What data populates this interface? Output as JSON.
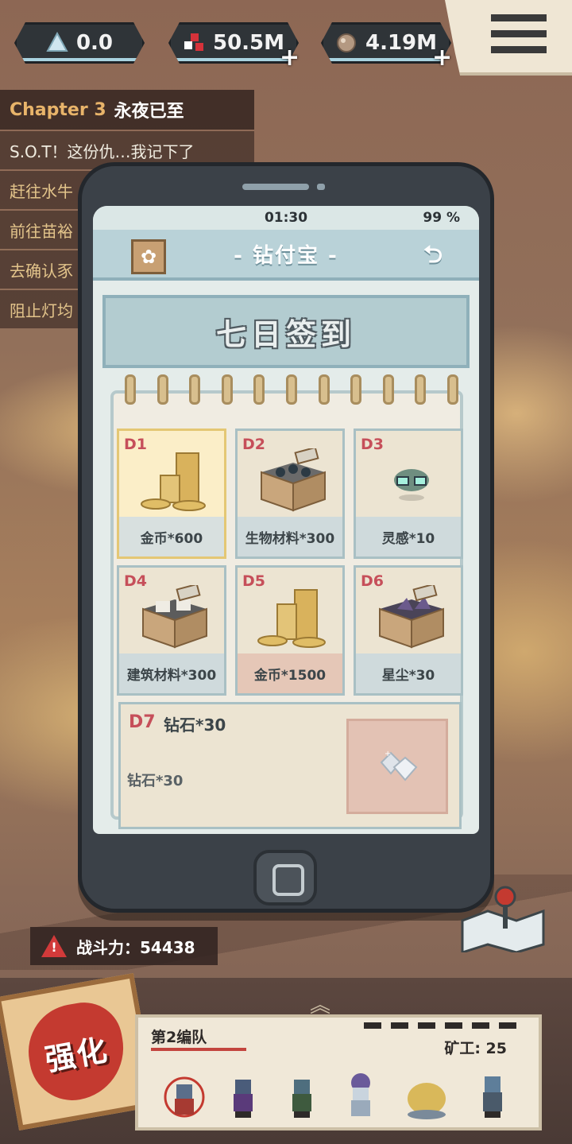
{
  "resources": [
    {
      "icon": "crystal-icon",
      "value": "0.0",
      "plus": false
    },
    {
      "icon": "gene-cube-icon",
      "value": "50.5M",
      "plus": true
    },
    {
      "icon": "ore-icon",
      "value": "4.19M",
      "plus": true
    }
  ],
  "quest": {
    "chapter_label": "Chapter 3",
    "chapter_name": "永夜已至",
    "lines": [
      "S.O.T！这份仇…我记下了",
      "赶往水牛",
      "前往苗裕",
      "去确认豕",
      "阻止灯均"
    ]
  },
  "phone": {
    "status_time": "01:30",
    "status_battery": "99 %",
    "app_title": "- 钻付宝 -",
    "back_label": "⮌",
    "banner_title": "七日签到",
    "days": [
      {
        "day": "D1",
        "label": "金币*600",
        "item": "coins"
      },
      {
        "day": "D2",
        "label": "生物材料*300",
        "item": "bio-box"
      },
      {
        "day": "D3",
        "label": "灵感*10",
        "item": "inspiration"
      },
      {
        "day": "D4",
        "label": "建筑材料*300",
        "item": "build-box"
      },
      {
        "day": "D5",
        "label": "金币*1500",
        "item": "coins"
      },
      {
        "day": "D6",
        "label": "星尘*30",
        "item": "stardust-box"
      }
    ],
    "day7": {
      "day": "D7",
      "title": "钻石*30",
      "desc": "钻石*30"
    }
  },
  "combat": {
    "label": "战斗力：54438"
  },
  "strengthen_label": "强化",
  "team": {
    "name": "第2编队",
    "miners_label": "矿工: 25",
    "member_count": 7
  },
  "colors": {
    "accent_red": "#c64f5a",
    "claimed_yellow": "#fbeec8",
    "title_blue": "#b9d2d8"
  }
}
